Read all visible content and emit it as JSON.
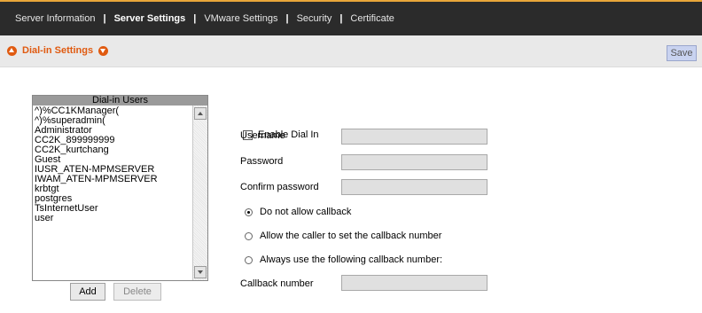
{
  "nav": {
    "tabs": [
      {
        "label": "Server Information",
        "active": false
      },
      {
        "label": "Server Settings",
        "active": true
      },
      {
        "label": "VMware Settings",
        "active": false
      },
      {
        "label": "Security",
        "active": false
      },
      {
        "label": "Certificate",
        "active": false
      }
    ],
    "separator": "|"
  },
  "subheader": {
    "title": "Dial-in Settings",
    "save_label": "Save"
  },
  "users": {
    "header": "Dial-in Users",
    "items": [
      "^)%CC1KManager(",
      "^)%superadmin(",
      "Administrator",
      "CC2K_899999999",
      "CC2K_kurtchang",
      "Guest",
      "IUSR_ATEN-MPMSERVER",
      "IWAM_ATEN-MPMSERVER",
      "krbtgt",
      "postgres",
      "TsInternetUser",
      "user"
    ],
    "add_label": "Add",
    "delete_label": "Delete"
  },
  "form": {
    "enable_label": "Enable Dial In",
    "enable_checked": false,
    "username_label": "Username",
    "username_value": "",
    "password_label": "Password",
    "password_value": "",
    "confirm_label": "Confirm password",
    "confirm_value": "",
    "callback_options": [
      {
        "label": "Do not allow callback",
        "checked": true
      },
      {
        "label": "Allow the caller to set the callback number",
        "checked": false
      },
      {
        "label": "Always use the following callback number:",
        "checked": false
      }
    ],
    "callback_number_label": "Callback number",
    "callback_number_value": ""
  },
  "colors": {
    "nav_bg": "#2b2b2b",
    "nav_accent": "#e8a63a",
    "title_orange": "#e05a10",
    "save_bg": "#c9d3f0"
  },
  "icons": {
    "title_left": "up-arrow-circle-icon",
    "title_right": "down-arrow-circle-icon"
  }
}
